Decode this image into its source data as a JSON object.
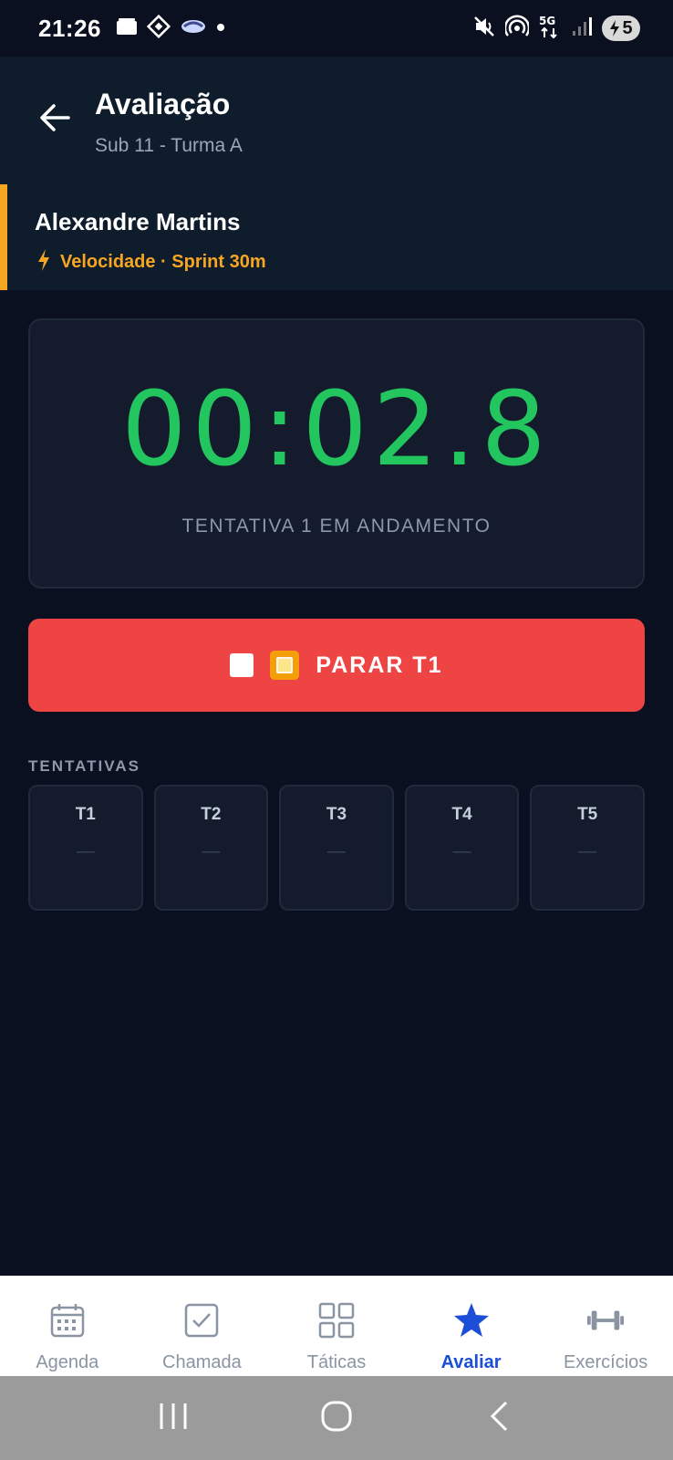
{
  "status_bar": {
    "time": "21:26",
    "battery_level": "5"
  },
  "header": {
    "title": "Avaliação",
    "subtitle": "Sub 11 - Turma A"
  },
  "athlete": {
    "name": "Alexandre Martins",
    "test": "Velocidade · Sprint 30m"
  },
  "timer": {
    "value": "00:02.8",
    "status": "TENTATIVA 1 EM ANDAMENTO"
  },
  "stop_button": {
    "label": "PARAR T1"
  },
  "attempts": {
    "title": "TENTATIVAS",
    "items": [
      {
        "label": "T1",
        "value": "—"
      },
      {
        "label": "T2",
        "value": "—"
      },
      {
        "label": "T3",
        "value": "—"
      },
      {
        "label": "T4",
        "value": "—"
      },
      {
        "label": "T5",
        "value": "—"
      }
    ]
  },
  "bottom_nav": {
    "items": [
      {
        "label": "Agenda",
        "icon": "calendar-icon"
      },
      {
        "label": "Chamada",
        "icon": "checkbox-icon"
      },
      {
        "label": "Táticas",
        "icon": "grid-icon"
      },
      {
        "label": "Avaliar",
        "icon": "star-icon",
        "active": true
      },
      {
        "label": "Exercícios",
        "icon": "dumbbell-icon"
      }
    ]
  },
  "colors": {
    "background": "#0b1020",
    "header": "#0f1c2c",
    "accent_orange": "#f5a623",
    "timer_green": "#22c55e",
    "stop_red": "#ef4444",
    "nav_active": "#1d4ed8"
  }
}
